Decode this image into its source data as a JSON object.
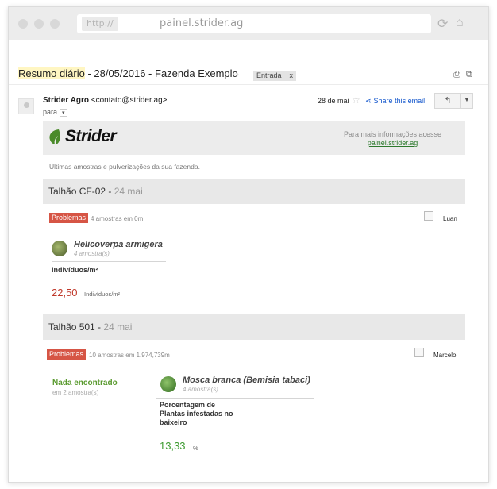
{
  "browser": {
    "protocol": "http://",
    "url": "painel.strider.ag",
    "back_icon": "chevron-left-icon",
    "forward_icon": "chevron-right-icon",
    "reload_icon": "reload-icon",
    "home_icon": "home-icon"
  },
  "email": {
    "subject_highlight": "Resumo diário",
    "subject_rest": " - 28/05/2016 - Fazenda Exemplo",
    "label": "Entrada",
    "label_remove": "x",
    "sender_name": "Strider Agro",
    "sender_email": "<contato@strider.ag>",
    "to_label": "para",
    "date": "28 de mai",
    "share_label": "Share this email"
  },
  "body": {
    "brand": "Strider",
    "info_text": "Para mais informações acesse",
    "info_link": "painel.strider.ag",
    "intro": "Últimas amostras e pulverizações da sua fazenda."
  },
  "fields": [
    {
      "name": "Talhão CF-02",
      "separator": " - ",
      "date": "24 mai",
      "status": "Problemas",
      "samples": "4 amostras em 0m",
      "user": "Luan",
      "pest_name": "Helicoverpa armigera",
      "pest_samples": "4 amostra(s)",
      "metric": "Indivíduos/m²",
      "value": "22,50",
      "unit": "Indivíduos/m²"
    },
    {
      "name": "Talhão 501",
      "separator": " - ",
      "date": "24 mai",
      "status": "Problemas",
      "samples": "10 amostras em 1.974,739m",
      "user": "Marcelo",
      "nothing_found": "Nada encontrado",
      "nothing_samples": "em 2 amostra(s)",
      "pest_name": "Mosca branca (Bemisia tabaci)",
      "pest_samples": "4 amostra(s)",
      "metric_lines": [
        "Porcentagem de",
        "Plantas infestadas no",
        "baixeiro"
      ],
      "value": "13,33",
      "unit": "%"
    }
  ],
  "colors": {
    "problem_badge": "#d65545",
    "value_red": "#c0392b",
    "value_green": "#3c9a2f",
    "link": "#1155cc",
    "brand_green": "#2d7a2d"
  }
}
